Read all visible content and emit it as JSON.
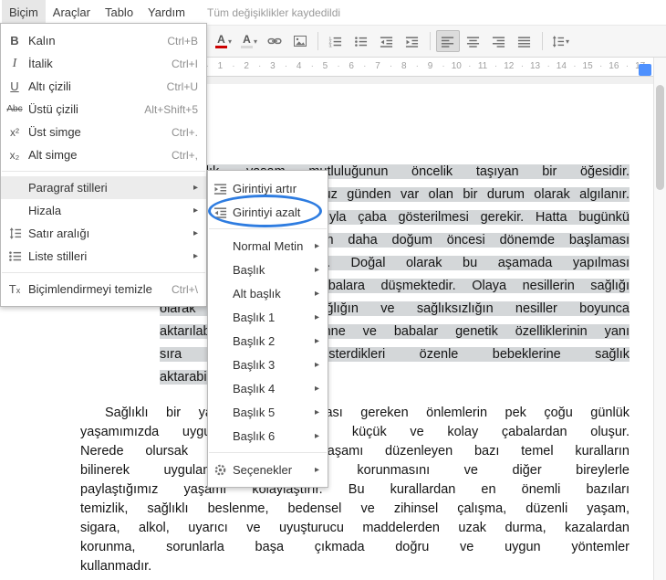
{
  "colors": {
    "selection": "#d4d7d9",
    "annotation": "#2e7ce0",
    "ruler-marker": "#4d90fe",
    "text-color-bar": "#cc0000",
    "highlight-bar": "#d8d8d8"
  },
  "menubar": {
    "items": [
      {
        "name": "menubar-bicim",
        "label": "Biçim",
        "cls": "open"
      },
      {
        "name": "menubar-araclar",
        "label": "Araçlar"
      },
      {
        "name": "menubar-tablo",
        "label": "Tablo"
      },
      {
        "name": "menubar-yardim",
        "label": "Yardım"
      }
    ],
    "status": "Tüm değişiklikler kaydedildi"
  },
  "toolbar": {
    "buttons": [
      {
        "name": "text-color-button",
        "icon": "text-color",
        "dd": "▾"
      },
      {
        "name": "highlight-color-button",
        "icon": "highlight-color",
        "dd": "▾"
      },
      {
        "name": "insert-link-button",
        "icon": "insert-link"
      },
      {
        "name": "insert-image-button",
        "icon": "insert-image"
      },
      {
        "cls": "tsep",
        "interactable": false
      },
      {
        "name": "numbered-list-button",
        "icon": "numbered-list"
      },
      {
        "name": "bulleted-list-button",
        "icon": "bulleted-list"
      },
      {
        "name": "decrease-indent-button",
        "icon": "indent-decrease"
      },
      {
        "name": "increase-indent-button",
        "icon": "indent-increase"
      },
      {
        "cls": "tsep",
        "interactable": false
      },
      {
        "name": "align-left-button",
        "icon": "align-left",
        "cls": "pressed"
      },
      {
        "name": "align-center-button",
        "icon": "align-center"
      },
      {
        "name": "align-right-button",
        "icon": "align-right"
      },
      {
        "name": "align-justify-button",
        "icon": "align-justify"
      },
      {
        "cls": "tsep",
        "interactable": false
      },
      {
        "name": "line-spacing-button",
        "icon": "line-spacing",
        "dd": "▾"
      }
    ]
  },
  "ruler": {
    "numbers": [
      "1",
      "2",
      "3",
      "4",
      "5",
      "6",
      "7",
      "8",
      "9",
      "10",
      "11",
      "12",
      "13",
      "14",
      "15",
      "16",
      "17"
    ]
  },
  "format_menu": {
    "items": [
      {
        "name": "menu-item-kalin",
        "icon": "bold",
        "label": "Kalın",
        "shortcut": "Ctrl+B"
      },
      {
        "name": "menu-item-italik",
        "icon": "italic",
        "label": "İtalik",
        "shortcut": "Ctrl+I"
      },
      {
        "name": "menu-item-alti-cizili",
        "icon": "underline",
        "label": "Altı çizili",
        "shortcut": "Ctrl+U"
      },
      {
        "name": "menu-item-ustu-cizili",
        "icon": "strikethrough",
        "label": "Üstü çizili",
        "shortcut": "Alt+Shift+5"
      },
      {
        "name": "menu-item-ust-simge",
        "icon": "superscript",
        "label": "Üst simge",
        "shortcut": "Ctrl+."
      },
      {
        "name": "menu-item-alt-simge",
        "icon": "subscript",
        "label": "Alt simge",
        "shortcut": "Ctrl+,"
      },
      {
        "cls": "msep",
        "interactable": false
      },
      {
        "name": "menu-item-paragraf-stilleri",
        "label": "Paragraf stilleri",
        "arrow": "▸",
        "cls": "hovered"
      },
      {
        "name": "menu-item-hizala",
        "label": "Hizala",
        "arrow": "▸"
      },
      {
        "name": "menu-item-satir-araligi",
        "icon": "line-spacing",
        "label": "Satır aralığı",
        "arrow": "▸"
      },
      {
        "name": "menu-item-liste-stilleri",
        "icon": "list-styles",
        "label": "Liste stilleri",
        "arrow": "▸"
      },
      {
        "cls": "msep",
        "interactable": false
      },
      {
        "name": "menu-item-bicimlendirmeyi-temizle",
        "icon": "clear-format",
        "label": "Biçimlendirmeyi temizle",
        "shortcut": "Ctrl+\\"
      }
    ]
  },
  "paragraph_styles_menu": {
    "items": [
      {
        "name": "submenu-item-girintiyi-artir",
        "icon": "indent-increase",
        "label": "Girintiyi artır"
      },
      {
        "name": "submenu-item-girintiyi-azalt",
        "icon": "indent-decrease",
        "label": "Girintiyi azalt"
      },
      {
        "cls": "msep",
        "interactable": false
      },
      {
        "name": "submenu-item-normal-metin",
        "label": "Normal Metin",
        "arrow": "▸"
      },
      {
        "name": "submenu-item-baslik",
        "label": "Başlık",
        "arrow": "▸"
      },
      {
        "name": "submenu-item-alt-baslik",
        "label": "Alt başlık",
        "arrow": "▸"
      },
      {
        "name": "submenu-item-baslik-1",
        "label": "Başlık 1",
        "arrow": "▸"
      },
      {
        "name": "submenu-item-baslik-2",
        "label": "Başlık 2",
        "arrow": "▸"
      },
      {
        "name": "submenu-item-baslik-3",
        "label": "Başlık 3",
        "arrow": "▸"
      },
      {
        "name": "submenu-item-baslik-4",
        "label": "Başlık 4",
        "arrow": "▸"
      },
      {
        "name": "submenu-item-baslik-5",
        "label": "Başlık 5",
        "arrow": "▸"
      },
      {
        "name": "submenu-item-baslik-6",
        "label": "Başlık 6",
        "arrow": "▸"
      },
      {
        "cls": "msep",
        "interactable": false
      },
      {
        "name": "submenu-item-secenekler",
        "icon": "gear",
        "label": "Seçenekler",
        "arrow": "▸"
      }
    ]
  },
  "annotation": {
    "shape": "ellipse",
    "highlights": "Girintiyi azalt"
  },
  "document": {
    "paragraph1_selected": true,
    "paragraph1_lines": [
      {
        "cls": "first",
        "text": "Sağlık, yaşam mutluluğunun öncelik taşıyan bir öğesidir."
      },
      {
        "text": "Sağlıklı olmak, doğduğumuz günden var olan bir durum olarak algılanır."
      },
      {
        "text": "Sağlığın korunması amacıyla çaba gösterilmesi gerekir. Hatta bugünkü"
      },
      {
        "text": "tıp, sağlığın korunmasının daha doğum öncesi dönemde başlaması"
      },
      {
        "text": "gerektiğini savunmaktadır. Doğal olarak bu aşamada yapılması"
      },
      {
        "text": "gerekenler anne ve babalara düşmektedir. Olaya nesillerin sağlığı"
      },
      {
        "text": "olarak bakıldığında sağlığın ve sağlıksızlığın nesiller boyunca"
      },
      {
        "text": "aktarılabildiği görülür. Anne ve babalar genetik özelliklerinin yanı"
      },
      {
        "text": "sıra kendilerine gösterdikleri özenle bebeklerine sağlık"
      },
      {
        "cls": "last",
        "text": "aktarabilmektedirler."
      }
    ],
    "paragraph2_lines": [
      {
        "cls": "first",
        "text": "Sağlıklı bir yaşam için alınması gereken önlemlerin pek çoğu günlük"
      },
      {
        "text": "yaşamımızda uygulanması gereken küçük ve kolay çabalardan oluşur."
      },
      {
        "text": "Nerede olursak olalım, toplu yaşamı düzenleyen bazı temel kuralların"
      },
      {
        "text": "bilinerek uygulanması, sağlığın korunmasını ve diğer bireylerle"
      },
      {
        "text": "paylaştığımız yaşamı kolaylaştırır. Bu kurallardan en önemli bazıları"
      },
      {
        "text": "temizlik, sağlıklı beslenme, bedensel ve zihinsel çalışma, düzenli yaşam,"
      },
      {
        "text": "sigara, alkol, uyarıcı ve uyuşturucu maddelerden uzak durma, kazalardan"
      },
      {
        "text": "korunma, sorunlarla başa çıkmada doğru ve uygun yöntemler"
      },
      {
        "cls": "last",
        "text": "kullanmadır."
      }
    ]
  }
}
